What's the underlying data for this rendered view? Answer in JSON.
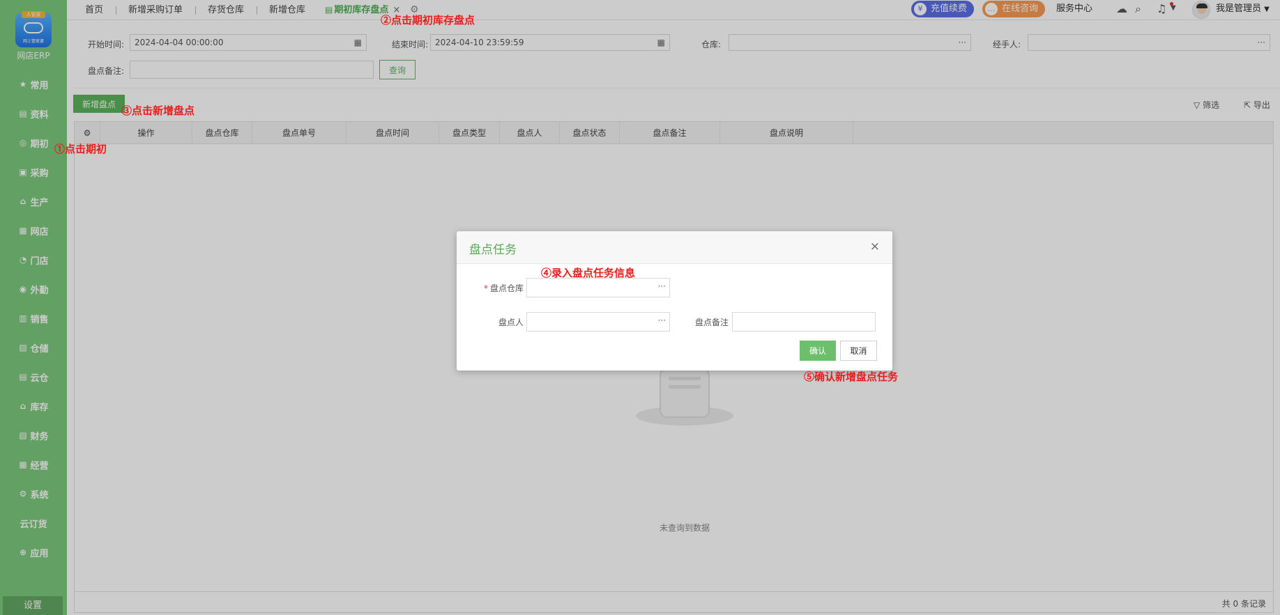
{
  "app": {
    "badge": "人管家",
    "logo_sub": "网上管家婆",
    "name": "网店ERP"
  },
  "sidebar": {
    "items": [
      {
        "label": "常用",
        "icon": "star-icon",
        "glyph": "★"
      },
      {
        "label": "资料",
        "icon": "document-icon",
        "glyph": "▤"
      },
      {
        "label": "期初",
        "icon": "clock-icon",
        "glyph": "◎"
      },
      {
        "label": "采购",
        "icon": "purchase-icon",
        "glyph": "▣"
      },
      {
        "label": "生产",
        "icon": "factory-icon",
        "glyph": "⌂"
      },
      {
        "label": "网店",
        "icon": "store-icon",
        "glyph": "▦"
      },
      {
        "label": "门店",
        "icon": "pie-icon",
        "glyph": "◔"
      },
      {
        "label": "外勤",
        "icon": "target-icon",
        "glyph": "◉"
      },
      {
        "label": "销售",
        "icon": "chart-icon",
        "glyph": "▥"
      },
      {
        "label": "仓储",
        "icon": "warehouse-icon",
        "glyph": "▨"
      },
      {
        "label": "云仓",
        "icon": "cloud-warehouse-icon",
        "glyph": "▤"
      },
      {
        "label": "库存",
        "icon": "home-icon",
        "glyph": "⌂"
      },
      {
        "label": "财务",
        "icon": "finance-icon",
        "glyph": "▧"
      },
      {
        "label": "经营",
        "icon": "trend-icon",
        "glyph": "▩"
      },
      {
        "label": "系统",
        "icon": "gear-icon",
        "glyph": "⚙"
      },
      {
        "label": "云订货",
        "icon": "",
        "glyph": ""
      },
      {
        "label": "应用",
        "icon": "plus-icon",
        "glyph": "⊕"
      }
    ],
    "settings_label": "设置"
  },
  "tabs": [
    {
      "label": "首页"
    },
    {
      "label": "新增采购订单"
    },
    {
      "label": "存货仓库"
    },
    {
      "label": "新增仓库"
    },
    {
      "label": "期初库存盘点",
      "close": "×"
    }
  ],
  "header": {
    "recharge": "充值续费",
    "consult": "在线咨询",
    "service": "服务中心",
    "user": "我是管理员"
  },
  "filters": {
    "start_label": "开始时间:",
    "start_value": "2024-04-04 00:00:00",
    "end_label": "结束时间:",
    "end_value": "2024-04-10 23:59:59",
    "warehouse_label": "仓库:",
    "handler_label": "经手人:",
    "remark_label": "盘点备注:",
    "query_button": "查询",
    "more": "···"
  },
  "toolbar": {
    "add_button": "新增盘点",
    "filter": "筛选",
    "export": "导出"
  },
  "table": {
    "columns": [
      "操作",
      "盘点仓库",
      "盘点单号",
      "盘点时间",
      "盘点类型",
      "盘点人",
      "盘点状态",
      "盘点备注",
      "盘点说明"
    ],
    "empty_text": "未查询到数据",
    "footer": "共 0 条记录"
  },
  "modal": {
    "title": "盘点任务",
    "close": "×",
    "required_mark": "*",
    "warehouse_label": "盘点仓库",
    "person_label": "盘点人",
    "remark_label": "盘点备注",
    "more": "···",
    "confirm": "确认",
    "cancel": "取消"
  },
  "annotations": {
    "step1": "①点击期初",
    "step2": "②点击期初库存盘点",
    "step3": "③点击新增盘点",
    "step4": "④录入盘点任务信息",
    "step5": "⑤确认新增盘点任务"
  },
  "colors": {
    "sidebar": "#7cc97c",
    "accent": "#5cb35c",
    "annotation": "#e81e1e",
    "recharge": "#5b6ee8",
    "consult": "#f79a52"
  }
}
